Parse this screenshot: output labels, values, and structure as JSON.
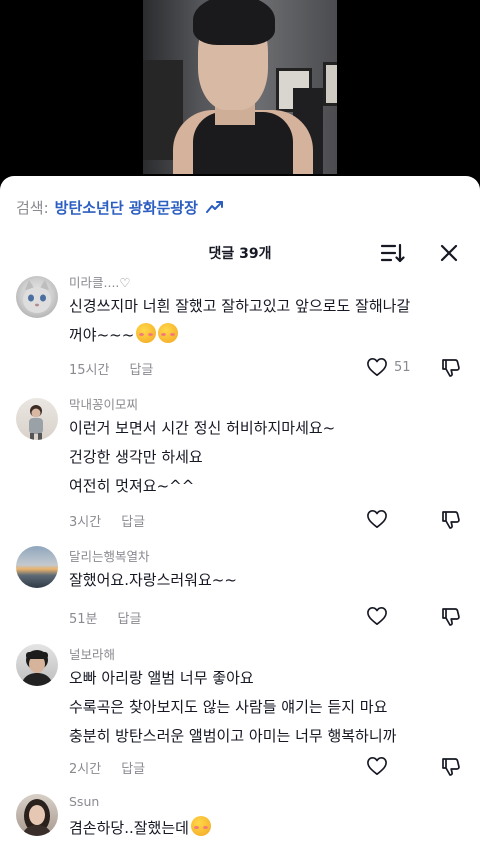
{
  "search": {
    "prefix": "검색:",
    "term": "방탄소년단 광화문광장"
  },
  "comments_header": {
    "title": "댓글 39개"
  },
  "icons": {
    "trend": "trending-arrow-icon",
    "sort": "sort-icon",
    "close": "close-icon",
    "like": "heart-icon",
    "dislike": "thumbs-down-icon",
    "emoji": "smiling-face-with-hearts-emoji"
  },
  "colors": {
    "search_term": "#2c5ec1",
    "secondary_text": "#8a8b91"
  },
  "comments": [
    {
      "user": "미라클....♡",
      "lines": [
        "신경쓰지마 너흰 잘했고 잘하고있고 앞으로도 잘해나갈",
        "꺼야~~~"
      ],
      "emoji_count": 2,
      "time": "15시간",
      "reply": "답글",
      "likes": "51"
    },
    {
      "user": "막내꽁이모찌",
      "lines": [
        "이런거 보면서 시간 정신 허비하지마세요~",
        "건강한 생각만 하세요",
        "여전히 멋져요~^^"
      ],
      "time": "3시간",
      "reply": "답글",
      "likes": ""
    },
    {
      "user": "달리는행복열차",
      "lines": [
        "잘했어요.자랑스러워요~~"
      ],
      "time": "51분",
      "reply": "답글",
      "likes": ""
    },
    {
      "user": "널보라해",
      "lines": [
        "오빠 아리랑 앨범 너무 좋아요",
        "수록곡은 찾아보지도 않는 사람들 얘기는 듣지 마요",
        "충분히 방탄스러운 앨범이고 아미는 너무 행복하니까"
      ],
      "time": "2시간",
      "reply": "답글",
      "likes": ""
    },
    {
      "user": "Ssun",
      "lines": [
        "겸손하당..잘했는데"
      ],
      "emoji_count": 1,
      "time": "",
      "reply": "",
      "likes": ""
    }
  ]
}
